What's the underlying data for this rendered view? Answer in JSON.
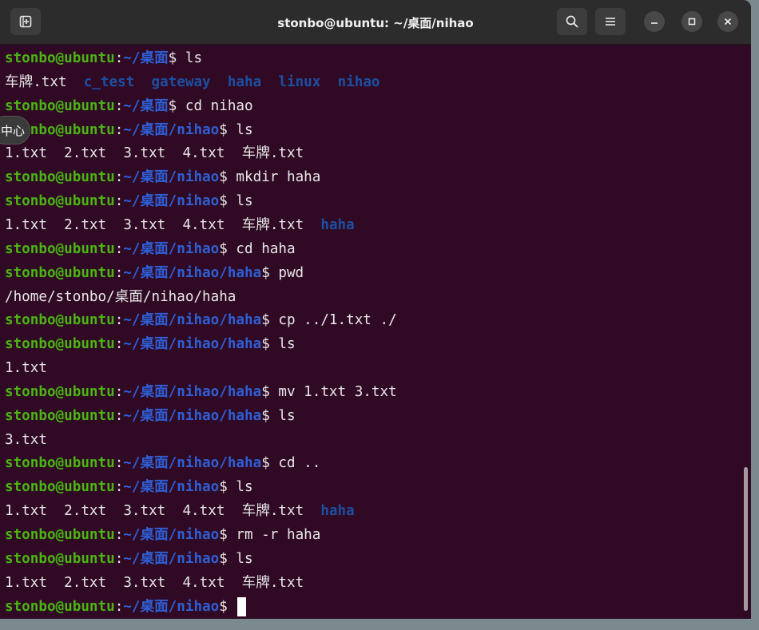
{
  "window": {
    "title": "stonbo@ubuntu: ~/桌面/nihao",
    "new_tab_icon": "new-tab-icon",
    "search_icon": "search-icon",
    "menu_icon": "hamburger-menu-icon",
    "minimize_icon": "minimize-icon",
    "maximize_icon": "maximize-icon",
    "close_icon": "close-icon"
  },
  "colors": {
    "background": "#300a24",
    "prompt_user": "#4ab513",
    "prompt_path": "#2e5fd6",
    "directory": "#1c4fa3",
    "text": "#e8e8e8"
  },
  "overlay_label": "中心",
  "prompt_user": "stonbo@ubuntu",
  "prompt_sep": ":",
  "dollar": "$",
  "lines": [
    {
      "type": "prompt",
      "path": "~/桌面",
      "cmd": "ls"
    },
    {
      "type": "output",
      "items": [
        {
          "t": "车牌.txt",
          "dir": false
        },
        {
          "t": "c_test",
          "dir": true
        },
        {
          "t": "gateway",
          "dir": true
        },
        {
          "t": "haha",
          "dir": true
        },
        {
          "t": "linux",
          "dir": true
        },
        {
          "t": "nihao",
          "dir": true
        }
      ]
    },
    {
      "type": "prompt",
      "path": "~/桌面",
      "cmd": "cd nihao"
    },
    {
      "type": "prompt",
      "path": "~/桌面/nihao",
      "cmd": "ls"
    },
    {
      "type": "output",
      "items": [
        {
          "t": "1.txt",
          "dir": false
        },
        {
          "t": "2.txt",
          "dir": false
        },
        {
          "t": "3.txt",
          "dir": false
        },
        {
          "t": "4.txt",
          "dir": false
        },
        {
          "t": "车牌.txt",
          "dir": false
        }
      ]
    },
    {
      "type": "prompt",
      "path": "~/桌面/nihao",
      "cmd": "mkdir haha"
    },
    {
      "type": "prompt",
      "path": "~/桌面/nihao",
      "cmd": "ls"
    },
    {
      "type": "output",
      "items": [
        {
          "t": "1.txt",
          "dir": false
        },
        {
          "t": "2.txt",
          "dir": false
        },
        {
          "t": "3.txt",
          "dir": false
        },
        {
          "t": "4.txt",
          "dir": false
        },
        {
          "t": "车牌.txt",
          "dir": false
        },
        {
          "t": "haha",
          "dir": true
        }
      ]
    },
    {
      "type": "prompt",
      "path": "~/桌面/nihao",
      "cmd": "cd haha"
    },
    {
      "type": "prompt",
      "path": "~/桌面/nihao/haha",
      "cmd": "pwd"
    },
    {
      "type": "text",
      "text": "/home/stonbo/桌面/nihao/haha"
    },
    {
      "type": "prompt",
      "path": "~/桌面/nihao/haha",
      "cmd": "cp ../1.txt ./"
    },
    {
      "type": "prompt",
      "path": "~/桌面/nihao/haha",
      "cmd": "ls"
    },
    {
      "type": "text",
      "text": "1.txt"
    },
    {
      "type": "prompt",
      "path": "~/桌面/nihao/haha",
      "cmd": "mv 1.txt 3.txt"
    },
    {
      "type": "prompt",
      "path": "~/桌面/nihao/haha",
      "cmd": "ls"
    },
    {
      "type": "text",
      "text": "3.txt"
    },
    {
      "type": "prompt",
      "path": "~/桌面/nihao/haha",
      "cmd": "cd .."
    },
    {
      "type": "prompt",
      "path": "~/桌面/nihao",
      "cmd": "ls"
    },
    {
      "type": "output",
      "items": [
        {
          "t": "1.txt",
          "dir": false
        },
        {
          "t": "2.txt",
          "dir": false
        },
        {
          "t": "3.txt",
          "dir": false
        },
        {
          "t": "4.txt",
          "dir": false
        },
        {
          "t": "车牌.txt",
          "dir": false
        },
        {
          "t": "haha",
          "dir": true
        }
      ]
    },
    {
      "type": "prompt",
      "path": "~/桌面/nihao",
      "cmd": "rm -r haha"
    },
    {
      "type": "prompt",
      "path": "~/桌面/nihao",
      "cmd": "ls"
    },
    {
      "type": "output",
      "items": [
        {
          "t": "1.txt",
          "dir": false
        },
        {
          "t": "2.txt",
          "dir": false
        },
        {
          "t": "3.txt",
          "dir": false
        },
        {
          "t": "4.txt",
          "dir": false
        },
        {
          "t": "车牌.txt",
          "dir": false
        }
      ]
    },
    {
      "type": "prompt",
      "path": "~/桌面/nihao",
      "cmd": "",
      "cursor": true
    }
  ]
}
